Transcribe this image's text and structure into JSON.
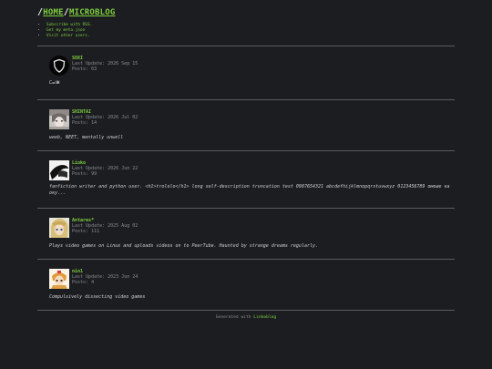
{
  "header": {
    "slash1": "/",
    "home": "HOME",
    "slash2": "/",
    "microblog": "MICROBLOG"
  },
  "links": [
    "Subscribe with RSS.",
    "Get my meta.json",
    "Visit other users."
  ],
  "profiles": [
    {
      "name": "SOXI",
      "last_update": "Last Update: 2026 Sep 15",
      "posts": "Posts: 63",
      "bio": "ⵎⴰⵏⵥ",
      "avatar_icon": "shield-icon"
    },
    {
      "name": "SHINTAI",
      "last_update": "Last Update: 2026 Jul 02",
      "posts": "Posts: 14",
      "bio": "weeb, NEET, mentally unwell",
      "avatar_icon": "anime-avatar"
    },
    {
      "name": "Lioko",
      "last_update": "Last Update: 2026 Jun 22",
      "posts": "Posts: 99",
      "bio": "fanfiction writer and python user. <h1>trololo</h1> long self-description truncation test 0987654321 abcdefhijklmnopqrstuvwxyz 0123456789 омоше ка оку...",
      "avatar_icon": "dark-avatar"
    },
    {
      "name": "Antares*",
      "last_update": "Last Update: 2025 Aug 02",
      "posts": "Posts: 111",
      "bio": "Plays video games on Linux and uploads videos on to PeerTube. Haunted by strange dreams regularly.",
      "avatar_icon": "anime-avatar"
    },
    {
      "name": "nin1",
      "last_update": "Last Update: 2023 Jun 24",
      "posts": "Posts: 4",
      "bio": "Compulsively dissecting video games",
      "avatar_icon": "anime-avatar"
    }
  ],
  "footer": {
    "text": "Generated with",
    "link": "Linkoblog"
  },
  "colors": {
    "background": "#1b1d20",
    "accent": "#7fcf3f",
    "muted": "#8a8d90",
    "separator": "#5a5d61"
  }
}
